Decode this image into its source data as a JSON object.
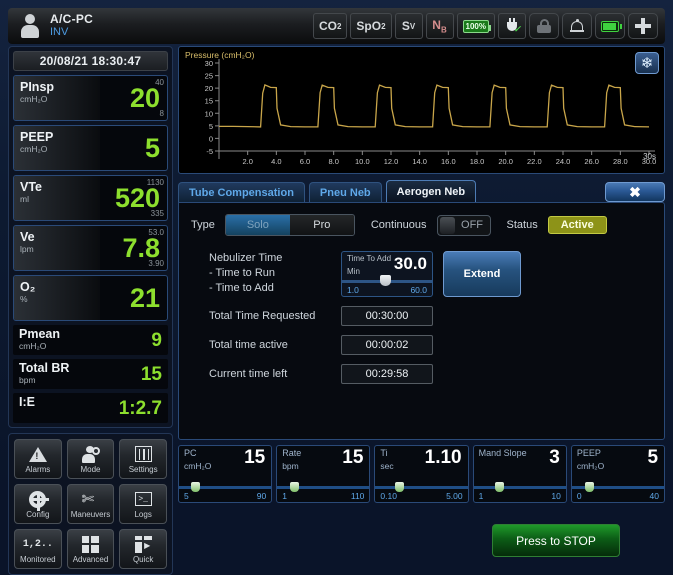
{
  "header": {
    "patient_mode": "A/C-PC",
    "ventilation_type": "INV",
    "person_icon": "person-icon",
    "icons": [
      {
        "name": "co2-button",
        "label": "CO",
        "sub": "2"
      },
      {
        "name": "spo2-button",
        "label": "SpO",
        "sub": "2"
      },
      {
        "name": "sv-button",
        "label": "S",
        "sub": "V"
      },
      {
        "name": "nb-button",
        "label": "N",
        "sub": "B"
      }
    ],
    "battery_percent": "100%",
    "plug_icon": "plug-connected-icon",
    "lock_icon": "lock-icon",
    "bell_icon": "alarm-bell-icon",
    "battery_icon": "battery-icon",
    "plus_icon": "plus-icon"
  },
  "sidebar": {
    "datetime": "20/08/21 18:30:47",
    "measurements": [
      {
        "name": "PInsp",
        "unit": "cmH₂O",
        "value": "20",
        "hi": "40",
        "lo": "8",
        "boxed": true
      },
      {
        "name": "PEEP",
        "unit": "cmH₂O",
        "value": "5",
        "hi": "",
        "lo": "",
        "boxed": true
      },
      {
        "name": "VTe",
        "unit": "ml",
        "value": "520",
        "hi": "1130",
        "lo": "335",
        "boxed": true
      },
      {
        "name": "Ve",
        "unit": "lpm",
        "value": "7.8",
        "hi": "53.0",
        "lo": "3.90",
        "boxed": true
      },
      {
        "name": "O₂",
        "unit": "%",
        "value": "21",
        "hi": "",
        "lo": "",
        "boxed": true
      },
      {
        "name": "Pmean",
        "unit": "cmH₂O",
        "value": "9",
        "hi": "",
        "lo": "",
        "boxed": false
      },
      {
        "name": "Total BR",
        "unit": "bpm",
        "value": "15",
        "hi": "",
        "lo": "",
        "boxed": false
      },
      {
        "name": "I:E",
        "unit": "",
        "value": "1:2.7",
        "hi": "",
        "lo": "",
        "boxed": false
      }
    ],
    "buttons": [
      {
        "label": "Alarms",
        "icon": "warning-triangle-icon"
      },
      {
        "label": "Mode",
        "icon": "person-gear-icon"
      },
      {
        "label": "Settings",
        "icon": "sliders-icon"
      },
      {
        "label": "Config",
        "icon": "gear-icon"
      },
      {
        "label": "Maneuvers",
        "icon": "tools-icon"
      },
      {
        "label": "Logs",
        "icon": "terminal-icon"
      },
      {
        "label": "Monitored",
        "icon": "numbers-icon",
        "text_icon": "1,2.."
      },
      {
        "label": "Advanced",
        "icon": "grid-squares-icon"
      },
      {
        "label": "Quick",
        "icon": "grid-play-icon"
      }
    ]
  },
  "waveform": {
    "freeze_icon": "freeze-snowflake-icon",
    "x_unit": "30s"
  },
  "chart_data": {
    "type": "line",
    "title": "Pressure (cmH₂O)",
    "xlabel": "",
    "ylabel": "Pressure (cmH₂O)",
    "ylim": [
      -5,
      30
    ],
    "xlim": [
      0,
      30
    ],
    "yticks": [
      30,
      25,
      20,
      15,
      10,
      5,
      0,
      -5
    ],
    "xticks": [
      2.0,
      4.0,
      6.0,
      8.0,
      10.0,
      12.0,
      14.0,
      16.0,
      18.0,
      20.0,
      22.0,
      24.0,
      26.0,
      28.0,
      30.0
    ],
    "grid": false,
    "legend": "none",
    "line_color": "#c9a64a",
    "series": [
      {
        "name": "Pressure",
        "baseline": 4.6,
        "peak": 20.5,
        "overshoot": 21.3,
        "breath_period": 4.0,
        "inspiratory_time": 1.1,
        "breath_onsets": [
          2.9,
          6.9,
          10.9,
          14.9,
          18.9,
          22.9,
          26.9
        ],
        "x": [
          0,
          1.0,
          2.0,
          2.9,
          3.05,
          3.2,
          3.6,
          4.0,
          4.05,
          4.3,
          5.0,
          6.0,
          6.9,
          7.05,
          7.2,
          7.6,
          8.0,
          8.05,
          8.3,
          9.0,
          10.0,
          10.9,
          11.05,
          11.2,
          11.6,
          12.0,
          12.05,
          12.3,
          13.0,
          14.0,
          14.9,
          15.05,
          15.2,
          15.6,
          16.0,
          16.05,
          16.3,
          17.0,
          18.0,
          18.9,
          19.05,
          19.2,
          19.6,
          20.0,
          20.05,
          20.3,
          21.0,
          22.0,
          22.9,
          23.05,
          23.2,
          23.6,
          24.0,
          24.05,
          24.3,
          25.0,
          26.0,
          26.9,
          27.05,
          27.2,
          27.6,
          28.0,
          28.05,
          28.3,
          29.0,
          30.0
        ],
        "y": [
          4.8,
          4.8,
          4.7,
          4.6,
          18.0,
          21.3,
          20.3,
          20.2,
          12.0,
          5.4,
          4.7,
          4.6,
          4.6,
          18.2,
          21.2,
          20.3,
          20.2,
          12.0,
          5.4,
          4.7,
          4.6,
          4.6,
          18.2,
          21.2,
          20.3,
          20.2,
          12.0,
          5.4,
          4.7,
          4.6,
          4.6,
          18.2,
          21.2,
          20.3,
          20.2,
          12.0,
          5.4,
          4.7,
          4.6,
          4.6,
          18.2,
          21.2,
          20.3,
          20.2,
          12.0,
          5.4,
          4.7,
          4.6,
          4.6,
          18.2,
          21.2,
          20.3,
          20.2,
          12.0,
          5.4,
          4.7,
          4.6,
          4.6,
          18.2,
          21.2,
          20.3,
          20.2,
          12.0,
          5.4,
          4.7,
          4.6
        ]
      }
    ]
  },
  "dialog": {
    "tabs": [
      {
        "label": "Tube Compensation",
        "active": false
      },
      {
        "label": "Pneu Neb",
        "active": false
      },
      {
        "label": "Aerogen Neb",
        "active": true
      }
    ],
    "close_icon": "close-x-icon",
    "type_label": "Type",
    "type_options": [
      {
        "label": "Solo",
        "selected": true
      },
      {
        "label": "Pro",
        "selected": false
      }
    ],
    "continuous_label": "Continuous",
    "continuous_state": "OFF",
    "status_label": "Status",
    "status_value": "Active",
    "status_color": "#8d9318",
    "nebulizer_lines": [
      "Nebulizer Time",
      "- Time to Run",
      "- Time to Add"
    ],
    "time_to_add": {
      "label": "Time To Add",
      "unit": "Min",
      "value": "30.0",
      "min": "1.0",
      "max": "60.0"
    },
    "extend_label": "Extend",
    "timers": [
      {
        "label": "Total Time Requested",
        "value": "00:30:00"
      },
      {
        "label": "Total time active",
        "value": "00:00:02"
      },
      {
        "label": "Current time left",
        "value": "00:29:58"
      }
    ],
    "stop_label": "Press to STOP"
  },
  "params": [
    {
      "name": "PC",
      "unit": "cmH₂O",
      "value": "15",
      "min": "5",
      "max": "90",
      "thumb_pct": 13
    },
    {
      "name": "Rate",
      "unit": "bpm",
      "value": "15",
      "min": "1",
      "max": "110",
      "thumb_pct": 14
    },
    {
      "name": "Ti",
      "unit": "sec",
      "value": "1.10",
      "min": "0.10",
      "max": "5.00",
      "thumb_pct": 21
    },
    {
      "name": "Mand Slope",
      "unit": "",
      "value": "3",
      "min": "1",
      "max": "10",
      "thumb_pct": 23
    },
    {
      "name": "PEEP",
      "unit": "cmH₂O",
      "value": "5",
      "min": "0",
      "max": "40",
      "thumb_pct": 14
    }
  ]
}
